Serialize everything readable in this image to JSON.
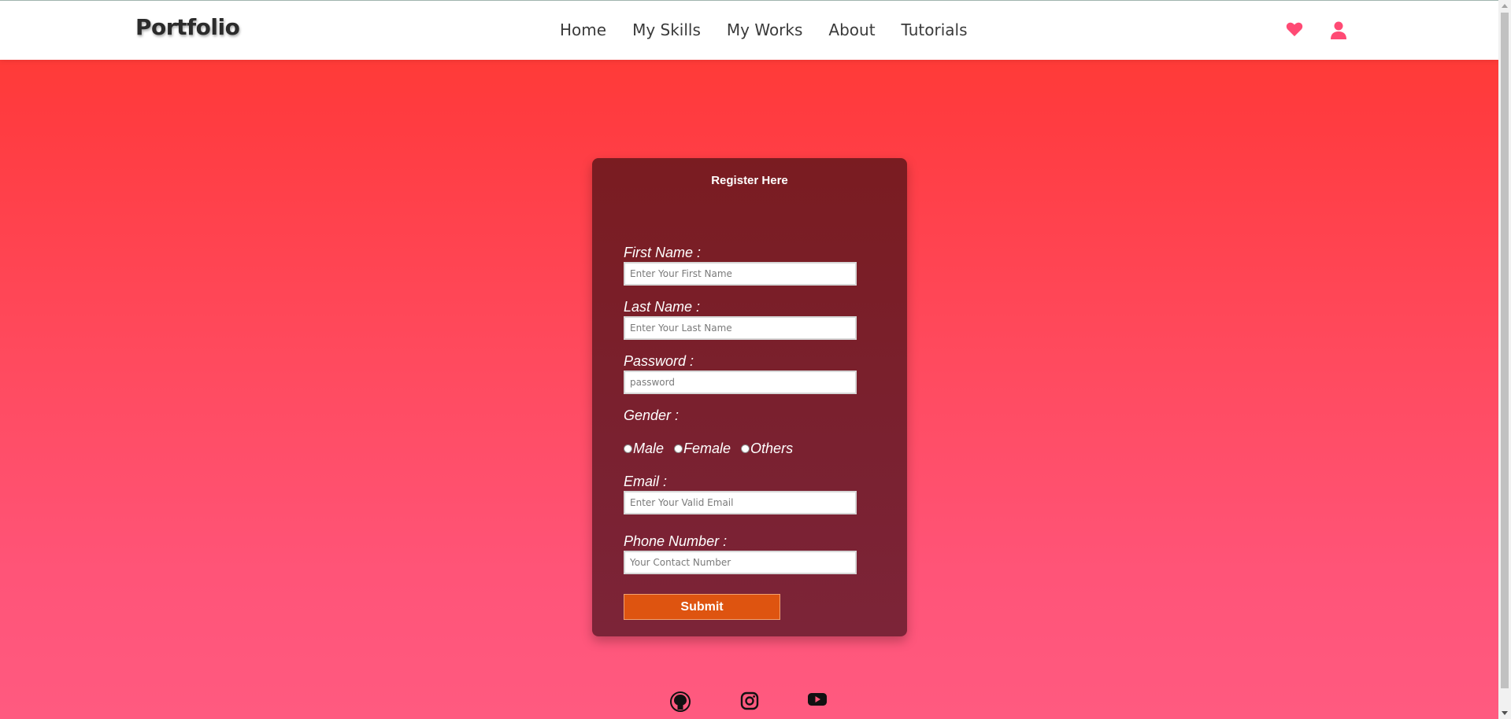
{
  "navbar": {
    "logo": "Portfolio",
    "links": [
      "Home",
      "My Skills",
      "My Works",
      "About",
      "Tutorials"
    ],
    "icons": [
      "heart-icon",
      "user-icon"
    ]
  },
  "form": {
    "title": "Register Here",
    "first_name": {
      "label": "First Name :",
      "placeholder": "Enter Your First Name",
      "value": ""
    },
    "last_name": {
      "label": "Last Name :",
      "placeholder": "Enter Your Last Name",
      "value": ""
    },
    "password": {
      "label": "Password :",
      "placeholder": "password",
      "value": ""
    },
    "gender": {
      "label": "Gender :",
      "options": [
        "Male",
        "Female",
        "Others"
      ]
    },
    "email": {
      "label": "Email :",
      "placeholder": "Enter Your Valid Email",
      "value": ""
    },
    "phone": {
      "label": "Phone Number :",
      "placeholder": "Your Contact Number",
      "value": ""
    },
    "submit_label": "Submit"
  },
  "social": [
    "github-icon",
    "instagram-icon",
    "youtube-icon"
  ],
  "colors": {
    "accent": "#ff4a74",
    "card": "#7a1c21",
    "submit": "#de5410"
  }
}
